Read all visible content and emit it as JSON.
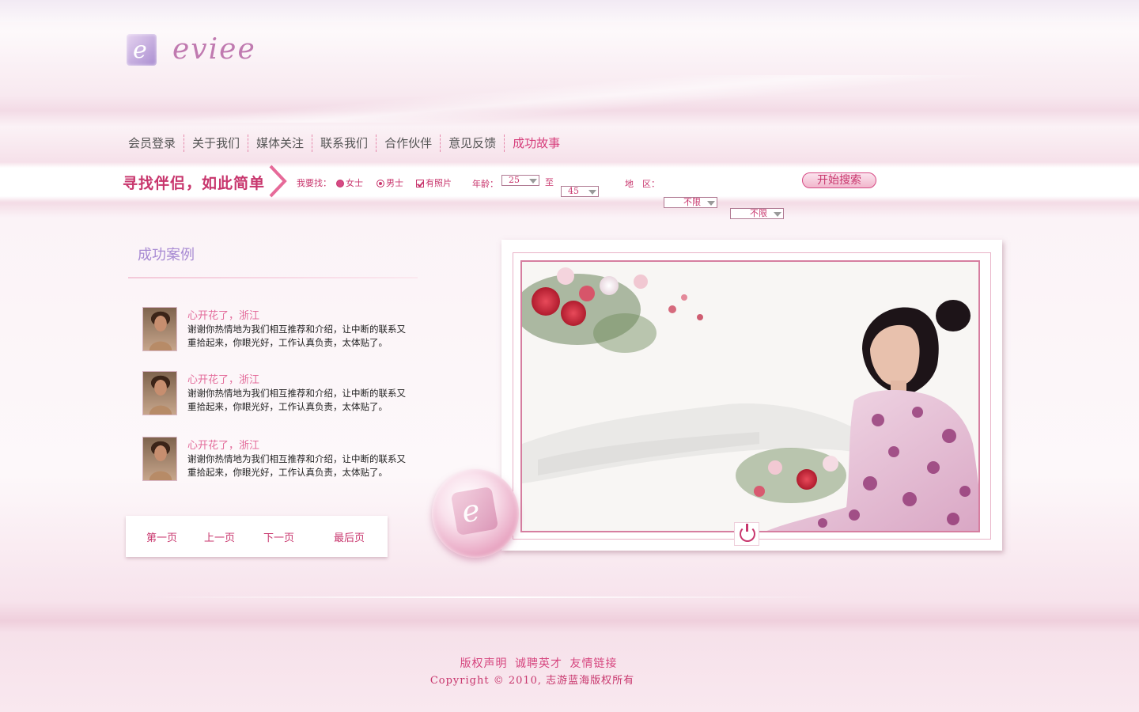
{
  "logo": {
    "mark": "e",
    "text": "eviee"
  },
  "nav": {
    "items": [
      {
        "label": "会员登录"
      },
      {
        "label": "关于我们"
      },
      {
        "label": "媒体关注"
      },
      {
        "label": "联系我们"
      },
      {
        "label": "合作伙伴"
      },
      {
        "label": "意见反馈"
      },
      {
        "label": "成功故事"
      }
    ]
  },
  "search": {
    "slogan": "寻找伴侣，如此简单",
    "seeking_label": "我要找：",
    "female_label": "女士",
    "male_label": "男士",
    "photo_label": "有照片",
    "age_label": "年龄：",
    "age_from": "25",
    "age_to_label": "至",
    "age_to": "45",
    "region_label": "地　区：",
    "region1": "不限",
    "region2": "不限",
    "button_label": "开始搜索"
  },
  "cases": {
    "title": "成功案例",
    "items": [
      {
        "title": "心开花了，浙江",
        "text": "谢谢你热情地为我们相互推荐和介绍，让中断的联系又重拾起来，你眼光好，工作认真负责，太体贴了。"
      },
      {
        "title": "心开花了，浙江",
        "text": "谢谢你热情地为我们相互推荐和介绍，让中断的联系又重拾起来，你眼光好，工作认真负责，太体贴了。"
      },
      {
        "title": "心开花了，浙江",
        "text": "谢谢你热情地为我们相互推荐和介绍，让中断的联系又重拾起来，你眼光好，工作认真负责，太体贴了。"
      }
    ]
  },
  "pager": {
    "first": "第一页",
    "prev": "上一页",
    "next": "下一页",
    "last": "最后页"
  },
  "footer": {
    "copyright_notice": "版权声明",
    "jobs": "诚聘英才",
    "links": "友情链接",
    "copyright": "Copyright © 2010, 志游蓝海版权所有"
  },
  "colors": {
    "accent": "#c8366d",
    "nav_active": "#d63e7b",
    "case_title": "#e36b9a",
    "section_title": "#a88bd3"
  },
  "icons": [
    "logo-icon",
    "chevron-right-icon",
    "power-icon",
    "dropdown-arrow-icon",
    "checkbox-icon",
    "radio-icon"
  ]
}
